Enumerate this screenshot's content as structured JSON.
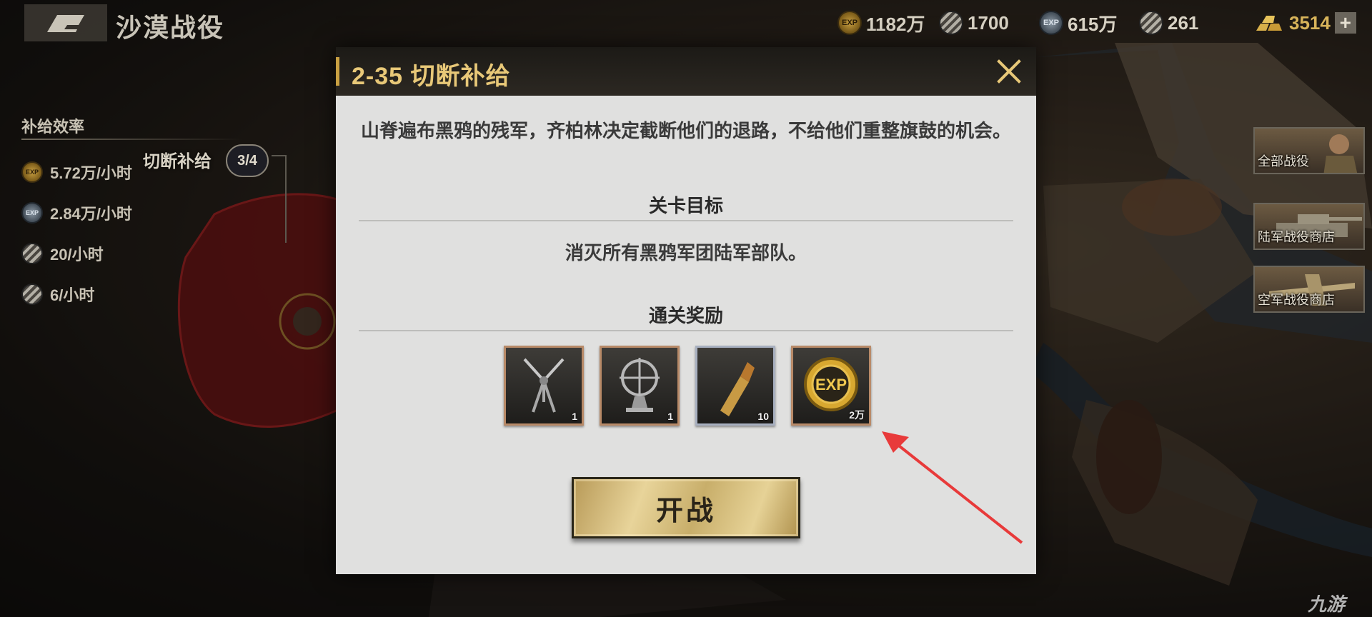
{
  "header": {
    "title": "沙漠战役"
  },
  "resources": [
    {
      "icon": "exp-gold-coin-icon",
      "value": "1182万"
    },
    {
      "icon": "striped-medal-icon",
      "value": "1700"
    },
    {
      "icon": "exp-silver-coin-icon",
      "value": "615万"
    },
    {
      "icon": "striped-medal-icon",
      "value": "261"
    },
    {
      "icon": "gold-bars-icon",
      "value": "3514"
    }
  ],
  "supply": {
    "title": "补给效率",
    "rows": [
      {
        "icon": "exp-gold-coin-icon",
        "value": "5.72万/小时"
      },
      {
        "icon": "exp-silver-coin-icon",
        "value": "2.84万/小时"
      },
      {
        "icon": "striped-medal-icon",
        "value": "20/小时"
      },
      {
        "icon": "striped-medal-icon",
        "value": "6/小时"
      }
    ]
  },
  "map_stage": {
    "label": "切断补给",
    "progress": "3/4"
  },
  "shortcuts": [
    {
      "label": "全部战役"
    },
    {
      "label": "陆军战役商店"
    },
    {
      "label": "空军战役商店"
    }
  ],
  "modal": {
    "title": "2-35 切断补给",
    "description": "山脊遍布黑鸦的残军，齐柏林决定截断他们的退路，不给他们重整旗鼓的机会。",
    "objective_heading": "关卡目标",
    "objective": "消灭所有黑鸦军团陆军部队。",
    "rewards_heading": "通关奖励",
    "rewards": [
      {
        "icon": "bipod-mount-icon",
        "qty": "1"
      },
      {
        "icon": "gun-sight-icon",
        "qty": "1"
      },
      {
        "icon": "bullet-icon",
        "qty": "10"
      },
      {
        "icon": "exp-coin-icon",
        "qty": "2万"
      }
    ],
    "start_label": "开战"
  },
  "watermark": "九游",
  "colors": {
    "accent_gold": "#c9a042",
    "title_gold": "#e8c878",
    "annotation_red": "#e83a3a",
    "enemy_zone": "#8c1a1a"
  }
}
